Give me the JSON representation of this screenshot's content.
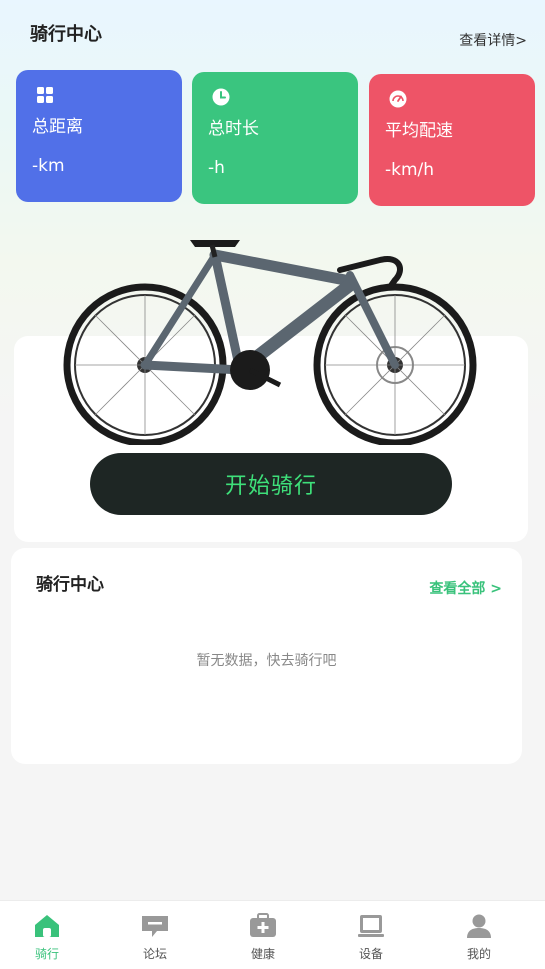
{
  "header": {
    "title": "骑行中心",
    "details_link": "查看详情>"
  },
  "stats": [
    {
      "label": "总距离",
      "value": "-km",
      "icon": "grid-icon",
      "color": "#5170e8"
    },
    {
      "label": "总时长",
      "value": "-h",
      "icon": "clock-icon",
      "color": "#3ac57f"
    },
    {
      "label": "平均配速",
      "value": "-km/h",
      "icon": "speedometer-icon",
      "color": "#ee5467"
    }
  ],
  "start_button": "开始骑行",
  "records": {
    "title": "骑行中心",
    "view_all": "查看全部 >",
    "empty": "暂无数据，快去骑行吧"
  },
  "tabs": [
    {
      "label": "骑行",
      "icon": "home-icon",
      "active": true
    },
    {
      "label": "论坛",
      "icon": "chat-icon"
    },
    {
      "label": "健康",
      "icon": "medkit-icon"
    },
    {
      "label": "设备",
      "icon": "device-icon"
    },
    {
      "label": "我的",
      "icon": "user-icon"
    }
  ],
  "colors": {
    "accent": "#39c27b",
    "button_bg": "#1e2624",
    "button_text": "#3ee07a"
  }
}
